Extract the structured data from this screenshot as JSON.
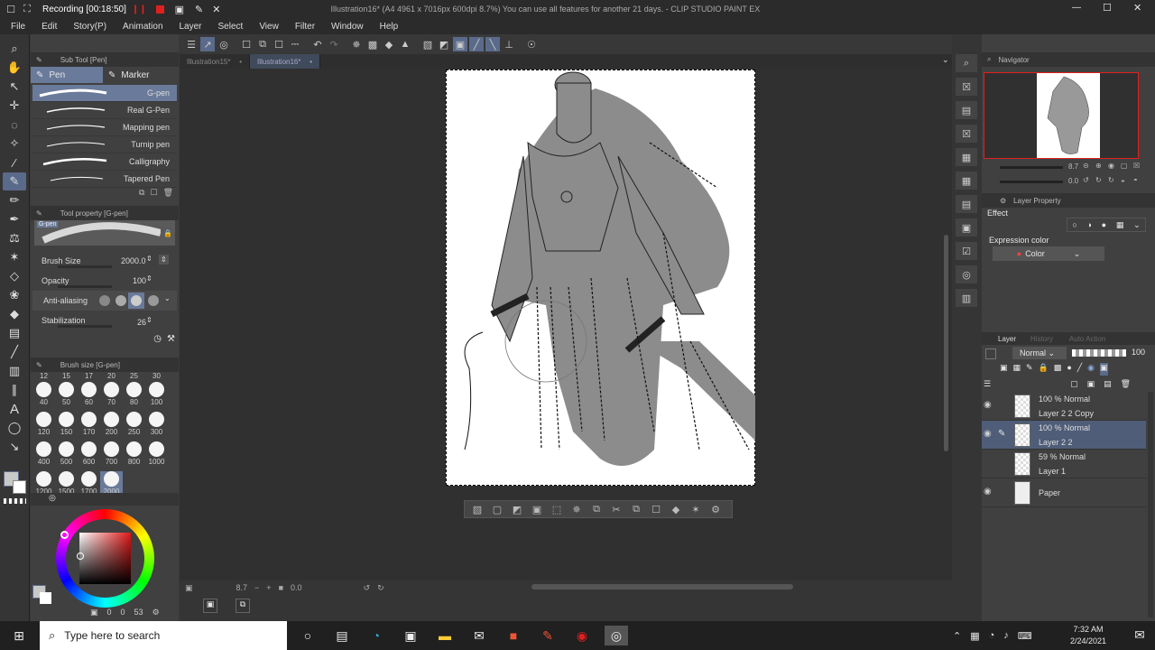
{
  "titlebar": {
    "recording_label": "Recording [00:18:50]",
    "window_title": "Illustration16* (A4 4961 x 7016px 600dpi 8.7%)  You can use all features for another 21 days. - CLIP STUDIO PAINT EX"
  },
  "menu": [
    "File",
    "Edit",
    "Story(P)",
    "Animation",
    "Layer",
    "Select",
    "View",
    "Filter",
    "Window",
    "Help"
  ],
  "subtool": {
    "header": "Sub Tool [Pen]",
    "tabs": [
      "Pen",
      "Marker"
    ],
    "brushes": [
      "G-pen",
      "Real G-Pen",
      "Mapping pen",
      "Turnip pen",
      "Calligraphy",
      "Tapered Pen"
    ]
  },
  "tool_property": {
    "header": "Tool property [G-pen]",
    "preview_label": "G-pen",
    "brush_size_label": "Brush Size",
    "brush_size_value": "2000.0",
    "opacity_label": "Opacity",
    "opacity_value": "100",
    "antialias_label": "Anti-aliasing",
    "stabilization_label": "Stabilization",
    "stabilization_value": "26"
  },
  "brush_size_panel": {
    "header": "Brush size [G-pen]",
    "top_row": [
      "12",
      "15",
      "17",
      "20",
      "25",
      "30"
    ],
    "sizes": [
      "40",
      "50",
      "60",
      "70",
      "80",
      "100",
      "120",
      "150",
      "170",
      "200",
      "250",
      "300",
      "400",
      "500",
      "600",
      "700",
      "800",
      "1000",
      "1200",
      "1500",
      "1700",
      "2000"
    ]
  },
  "color": {
    "main": "#c8c8c8",
    "sub": "#ffffff",
    "readout": [
      "0",
      "0",
      "53"
    ]
  },
  "doc_tabs": [
    "Illustration15*",
    "Illustration16*"
  ],
  "canvas_footer": {
    "zoom": "8.7",
    "angle": "0.0"
  },
  "navigator": {
    "header": "Navigator",
    "zoom": "8.7",
    "angle": "0.0"
  },
  "layer_property": {
    "header": "Layer Property",
    "effect_label": "Effect",
    "expression_color_label": "Expression color",
    "expression_color_value": "Color"
  },
  "layer_panel": {
    "tabs": [
      "Layer",
      "History",
      "Auto Action"
    ],
    "blend_mode": "Normal",
    "opacity": "100",
    "layers": [
      {
        "mode": "100 % Normal",
        "name": "Layer 2 2 Copy",
        "visible": true,
        "active": false
      },
      {
        "mode": "100 % Normal",
        "name": "Layer 2 2",
        "visible": true,
        "active": true
      },
      {
        "mode": "59 % Normal",
        "name": "Layer 1",
        "visible": false,
        "active": false
      },
      {
        "mode": "",
        "name": "Paper",
        "visible": true,
        "active": false
      }
    ]
  },
  "taskbar": {
    "search_placeholder": "Type here to search",
    "time": "7:32 AM",
    "date": "2/24/2021"
  },
  "colors": {
    "accent": "#6a7a9a",
    "figure_fill": "#8c8c8c",
    "record_red": "#e02020"
  }
}
